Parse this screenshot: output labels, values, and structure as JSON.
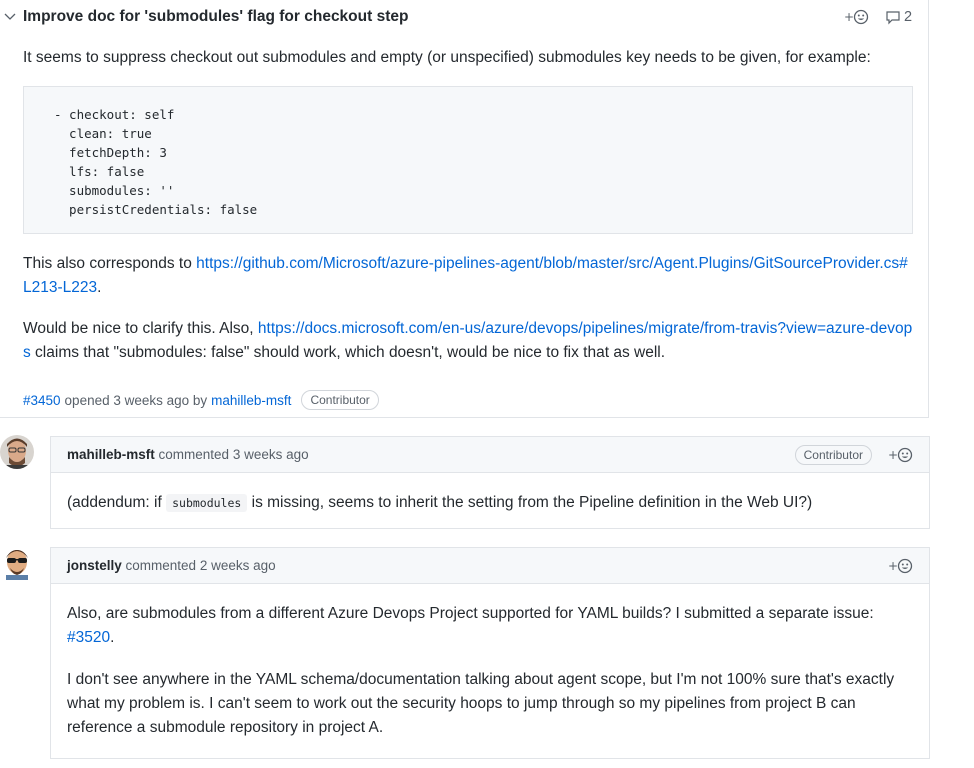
{
  "issue": {
    "title": "Improve doc for 'submodules' flag for checkout step",
    "comment_count": "2",
    "para1": "It seems to suppress checkout out submodules and empty (or unspecified) submodules key needs to be given, for example:",
    "code_lines": [
      "- checkout: self",
      "  clean: true",
      "  fetchDepth: 3",
      "  lfs: false",
      "  submodules: ''",
      "  persistCredentials: false"
    ],
    "para2_prefix": "This also corresponds to ",
    "para2_link": "https://github.com/Microsoft/azure-pipelines-agent/blob/master/src/Agent.Plugins/GitSourceProvider.cs#L213-L223",
    "para2_suffix": ".",
    "para3_prefix": "Would be nice to clarify this. Also, ",
    "para3_link": "https://docs.microsoft.com/en-us/azure/devops/pipelines/migrate/from-travis?view=azure-devops",
    "para3_suffix": " claims that \"submodules: false\" should work, which doesn't, would be nice to fix that as well.",
    "number": "#3450",
    "opened_text": "opened 3 weeks ago by",
    "author": "mahilleb-msft",
    "author_badge": "Contributor"
  },
  "comments": [
    {
      "author": "mahilleb-msft",
      "action": "commented 3 weeks ago",
      "badge": "Contributor",
      "body_prefix": "(addendum: if ",
      "body_code": "submodules",
      "body_suffix": " is missing, seems to inherit the setting from the Pipeline definition in the Web UI?)"
    },
    {
      "author": "jonstelly",
      "action": "commented 2 weeks ago",
      "para1_prefix": "Also, are submodules from a different Azure Devops Project supported for YAML builds? I submitted a separate issue: ",
      "para1_link": "#3520",
      "para1_suffix": ".",
      "para2": "I don't see anywhere in the YAML schema/documentation talking about agent scope, but I'm not 100% sure that's exactly what my problem is. I can't seem to work out the security hoops to jump through so my pipelines from project B can reference a submodule repository in project A."
    }
  ],
  "icons": {
    "collapse": "chevron-down-icon",
    "reaction": "add-reaction-icon",
    "comments": "comment-icon"
  },
  "colors": {
    "link": "#0366d6",
    "text": "#24292e",
    "muted": "#586069",
    "border": "#e1e4e8",
    "header_bg": "#f6f8fa"
  }
}
